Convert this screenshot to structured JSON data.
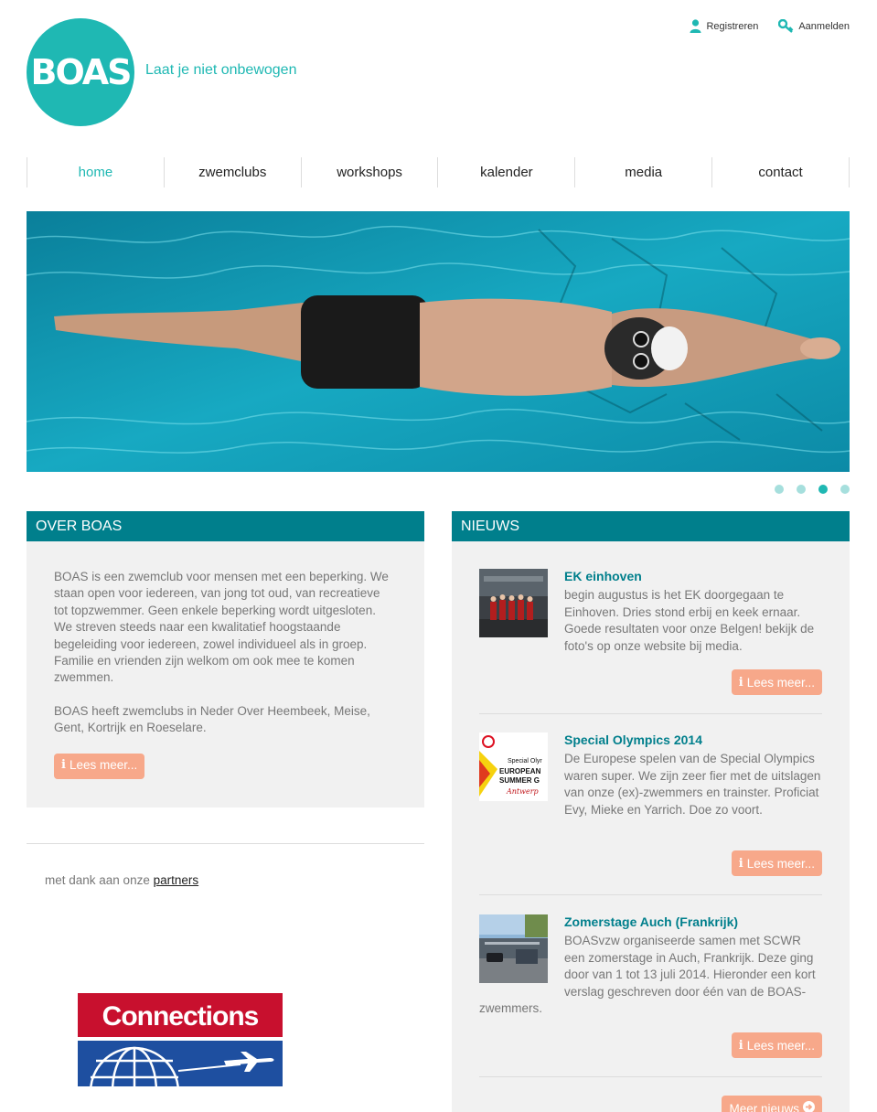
{
  "header": {
    "logo_text": "BOAS",
    "tagline": "Laat je niet onbewogen",
    "register_label": "Registreren",
    "login_label": "Aanmelden"
  },
  "nav": {
    "items": [
      {
        "label": "home",
        "active": true
      },
      {
        "label": "zwemclubs"
      },
      {
        "label": "workshops"
      },
      {
        "label": "kalender"
      },
      {
        "label": "media"
      },
      {
        "label": "contact"
      }
    ]
  },
  "slider": {
    "dot_count": 4,
    "active_index": 2
  },
  "over": {
    "title": "OVER BOAS",
    "paragraph1": "BOAS is een zwemclub voor mensen met een beperking. We staan open voor iedereen, van jong tot oud, van recreatieve tot topzwemmer. Geen enkele beperking wordt uitgesloten. We streven steeds naar een kwalitatief hoogstaande begeleiding voor iedereen, zowel individueel als in groep. Familie en vrienden zijn welkom om ook mee te komen zwemmen.",
    "paragraph2": "BOAS heeft zwemclubs in Neder Over Heembeek, Meise, Gent, Kortrijk en Roeselare.",
    "button_label": "Lees meer..."
  },
  "thanks": {
    "prefix": "met dank aan onze",
    "link": "partners"
  },
  "partner": {
    "name": "Connections"
  },
  "news": {
    "title": "NIEUWS",
    "items": [
      {
        "title": "EK einhoven",
        "text": "begin augustus is het EK doorgegaan te Einhoven. Dries stond erbij en keek ernaar. Goede resultaten voor onze Belgen! bekijk de foto's op onze website bij media.",
        "button_label": "Lees meer..."
      },
      {
        "title": "Special Olympics 2014",
        "text": "De Europese spelen van de Special Olympics waren super. We zijn zeer fier met de uitslagen van onze (ex)-zwemmers en trainster. Proficiat Evy, Mieke en Yarrich. Doe zo voort.",
        "button_label": "Lees meer...",
        "thumb_text1": "Special Olyr",
        "thumb_text2": "EUROPEAN",
        "thumb_text3": "SUMMER G",
        "thumb_text4": "Antwerp"
      },
      {
        "title": "Zomerstage Auch (Frankrijk)",
        "text": "BOASvzw organiseerde samen met SCWR een zomerstage in Auch, Frankrijk. Deze ging door van 1 tot 13 juli 2014. Hieronder een kort verslag geschreven door één van de BOAS-zwemmers.",
        "button_label": "Lees meer..."
      }
    ],
    "more_label": "Meer nieuws"
  },
  "colors": {
    "brand": "#1fb8b3",
    "header_bar": "#007f8c",
    "button": "#f7a88a",
    "panel_bg": "#f1f1f1"
  }
}
